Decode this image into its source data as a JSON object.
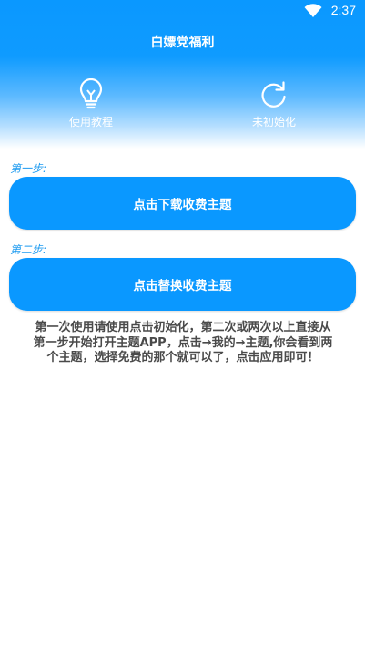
{
  "status_bar": {
    "time": "2:37",
    "icons": [
      "wifi-icon"
    ]
  },
  "app": {
    "title": "白嫖党福利"
  },
  "nav": [
    {
      "label": "使用教程",
      "icon": "lightbulb-icon"
    },
    {
      "label": "未初始化",
      "icon": "refresh-icon"
    }
  ],
  "steps": [
    {
      "label": "第一步:",
      "button": "点击下载收费主题"
    },
    {
      "label": "第二步:",
      "button": "点击替换收费主题"
    }
  ],
  "info": {
    "lines": [
      "第一次使用请使用点击初始化，第二次或两次以上直接从",
      "第一步开始打开主题APP，点击→我的→主题,你会看到两",
      "个主题，选择免费的那个就可以了，点击应用即可！"
    ]
  },
  "colors": {
    "accent": "#0a98ff",
    "step_label": "#1e9bf0",
    "text": "#4a4a4a"
  }
}
